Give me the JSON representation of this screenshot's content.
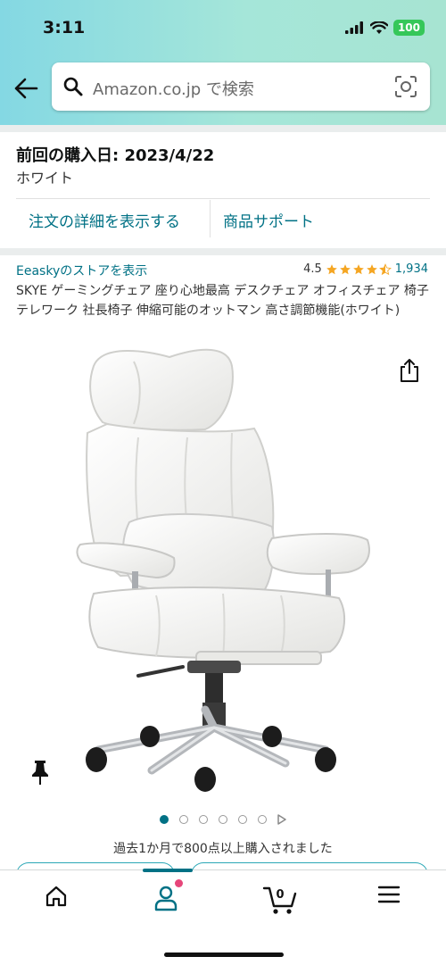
{
  "status_bar": {
    "time": "3:11",
    "battery": "100"
  },
  "search": {
    "placeholder": "Amazon.co.jp で検索"
  },
  "order": {
    "purchase_date": "前回の購入日: 2023/4/22",
    "variant": "ホワイト",
    "order_details_link": "注文の詳細を表示する",
    "product_support_link": "商品サポート"
  },
  "product": {
    "store_link": "Eeaskyのストアを表示",
    "rating": "4.5",
    "rating_stars": 4.5,
    "review_count": "1,934",
    "title": "SKYE ゲーミングチェア 座り心地最高 デスクチェア オフィスチェア 椅子 テレワーク 社長椅子 伸縮可能のオットマン 高さ調節機能(ホワイト)",
    "image_count": 6,
    "active_image": 1,
    "bought_text": "過去1か月で800点以上購入されました"
  },
  "bottom_nav": {
    "cart_count": "0",
    "items": [
      "home-icon",
      "profile-icon",
      "cart-icon",
      "menu-icon"
    ],
    "active": "profile"
  },
  "colors": {
    "header_gradient_start": "#84d8e3",
    "header_gradient_end": "#a7e4d2",
    "link": "#007185",
    "star": "#f5a623",
    "notification": "#e6467a"
  }
}
